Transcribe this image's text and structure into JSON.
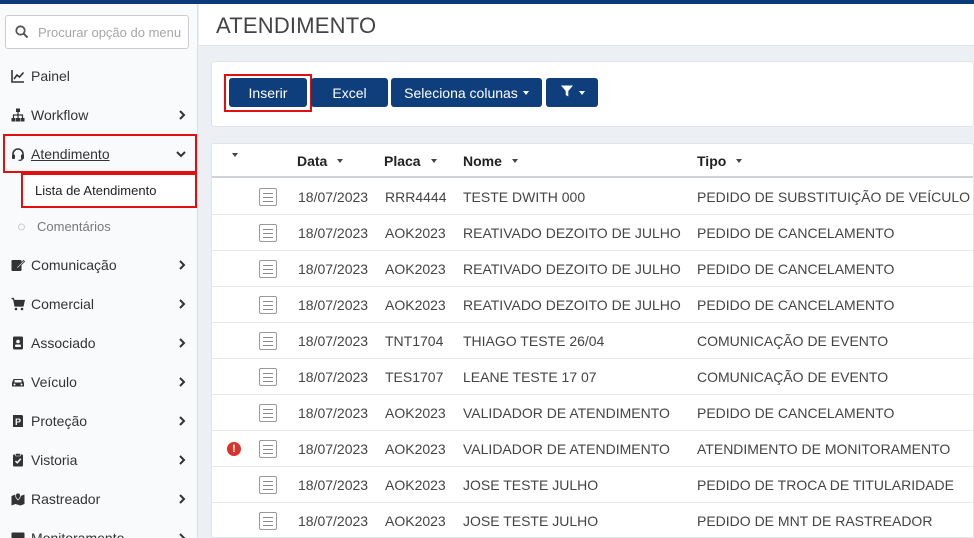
{
  "sidebar": {
    "search_placeholder": "Procurar opção do menu",
    "items": [
      {
        "label": "Painel",
        "icon": "chart-line-icon",
        "has_chevron": false
      },
      {
        "label": "Workflow",
        "icon": "sitemap-icon",
        "has_chevron": true
      },
      {
        "label": "Atendimento",
        "icon": "headset-icon",
        "has_chevron": true,
        "active": true
      },
      {
        "label": "Comunicação",
        "icon": "edit-icon",
        "has_chevron": true
      },
      {
        "label": "Comercial",
        "icon": "cart-icon",
        "has_chevron": true
      },
      {
        "label": "Associado",
        "icon": "id-card-icon",
        "has_chevron": true
      },
      {
        "label": "Veículo",
        "icon": "car-icon",
        "has_chevron": true
      },
      {
        "label": "Proteção",
        "icon": "shield-icon",
        "has_chevron": true
      },
      {
        "label": "Vistoria",
        "icon": "clipboard-check-icon",
        "has_chevron": true
      },
      {
        "label": "Rastreador",
        "icon": "map-marker-icon",
        "has_chevron": true
      },
      {
        "label": "Monitoramento",
        "icon": "monitor-icon",
        "has_chevron": true
      }
    ],
    "subitems": [
      {
        "label": "Lista de Atendimento",
        "active": true
      },
      {
        "label": "Comentários",
        "active": false
      }
    ]
  },
  "header": {
    "title": "ATENDIMENTO"
  },
  "toolbar": {
    "insert_label": "Inserir",
    "excel_label": "Excel",
    "columns_label": "Seleciona colunas"
  },
  "table": {
    "columns": [
      "Data",
      "Placa",
      "Nome",
      "Tipo"
    ],
    "rows": [
      {
        "alert": false,
        "data": "18/07/2023",
        "placa": "RRR4444",
        "nome": "TESTE DWITH 000",
        "tipo": "PEDIDO DE SUBSTITUIÇÃO DE VEÍCULO"
      },
      {
        "alert": false,
        "data": "18/07/2023",
        "placa": "AOK2023",
        "nome": "REATIVADO DEZOITO DE JULHO",
        "tipo": "PEDIDO DE CANCELAMENTO"
      },
      {
        "alert": false,
        "data": "18/07/2023",
        "placa": "AOK2023",
        "nome": "REATIVADO DEZOITO DE JULHO",
        "tipo": "PEDIDO DE CANCELAMENTO"
      },
      {
        "alert": false,
        "data": "18/07/2023",
        "placa": "AOK2023",
        "nome": "REATIVADO DEZOITO DE JULHO",
        "tipo": "PEDIDO DE CANCELAMENTO"
      },
      {
        "alert": false,
        "data": "18/07/2023",
        "placa": "TNT1704",
        "nome": "THIAGO TESTE 26/04",
        "tipo": "COMUNICAÇÃO DE EVENTO"
      },
      {
        "alert": false,
        "data": "18/07/2023",
        "placa": "TES1707",
        "nome": "LEANE TESTE 17 07",
        "tipo": "COMUNICAÇÃO DE EVENTO"
      },
      {
        "alert": false,
        "data": "18/07/2023",
        "placa": "AOK2023",
        "nome": "VALIDADOR DE ATENDIMENTO",
        "tipo": "PEDIDO DE CANCELAMENTO"
      },
      {
        "alert": true,
        "data": "18/07/2023",
        "placa": "AOK2023",
        "nome": "VALIDADOR DE ATENDIMENTO",
        "tipo": "ATENDIMENTO DE MONITORAMENTO"
      },
      {
        "alert": false,
        "data": "18/07/2023",
        "placa": "AOK2023",
        "nome": "JOSE TESTE JULHO",
        "tipo": "PEDIDO DE TROCA DE TITULARIDADE"
      },
      {
        "alert": false,
        "data": "18/07/2023",
        "placa": "AOK2023",
        "nome": "JOSE TESTE JULHO",
        "tipo": "PEDIDO DE MNT DE RASTREADOR"
      }
    ]
  },
  "colors": {
    "primary": "#0e3f7c",
    "highlight": "#e01010",
    "alert": "#d9342b"
  }
}
